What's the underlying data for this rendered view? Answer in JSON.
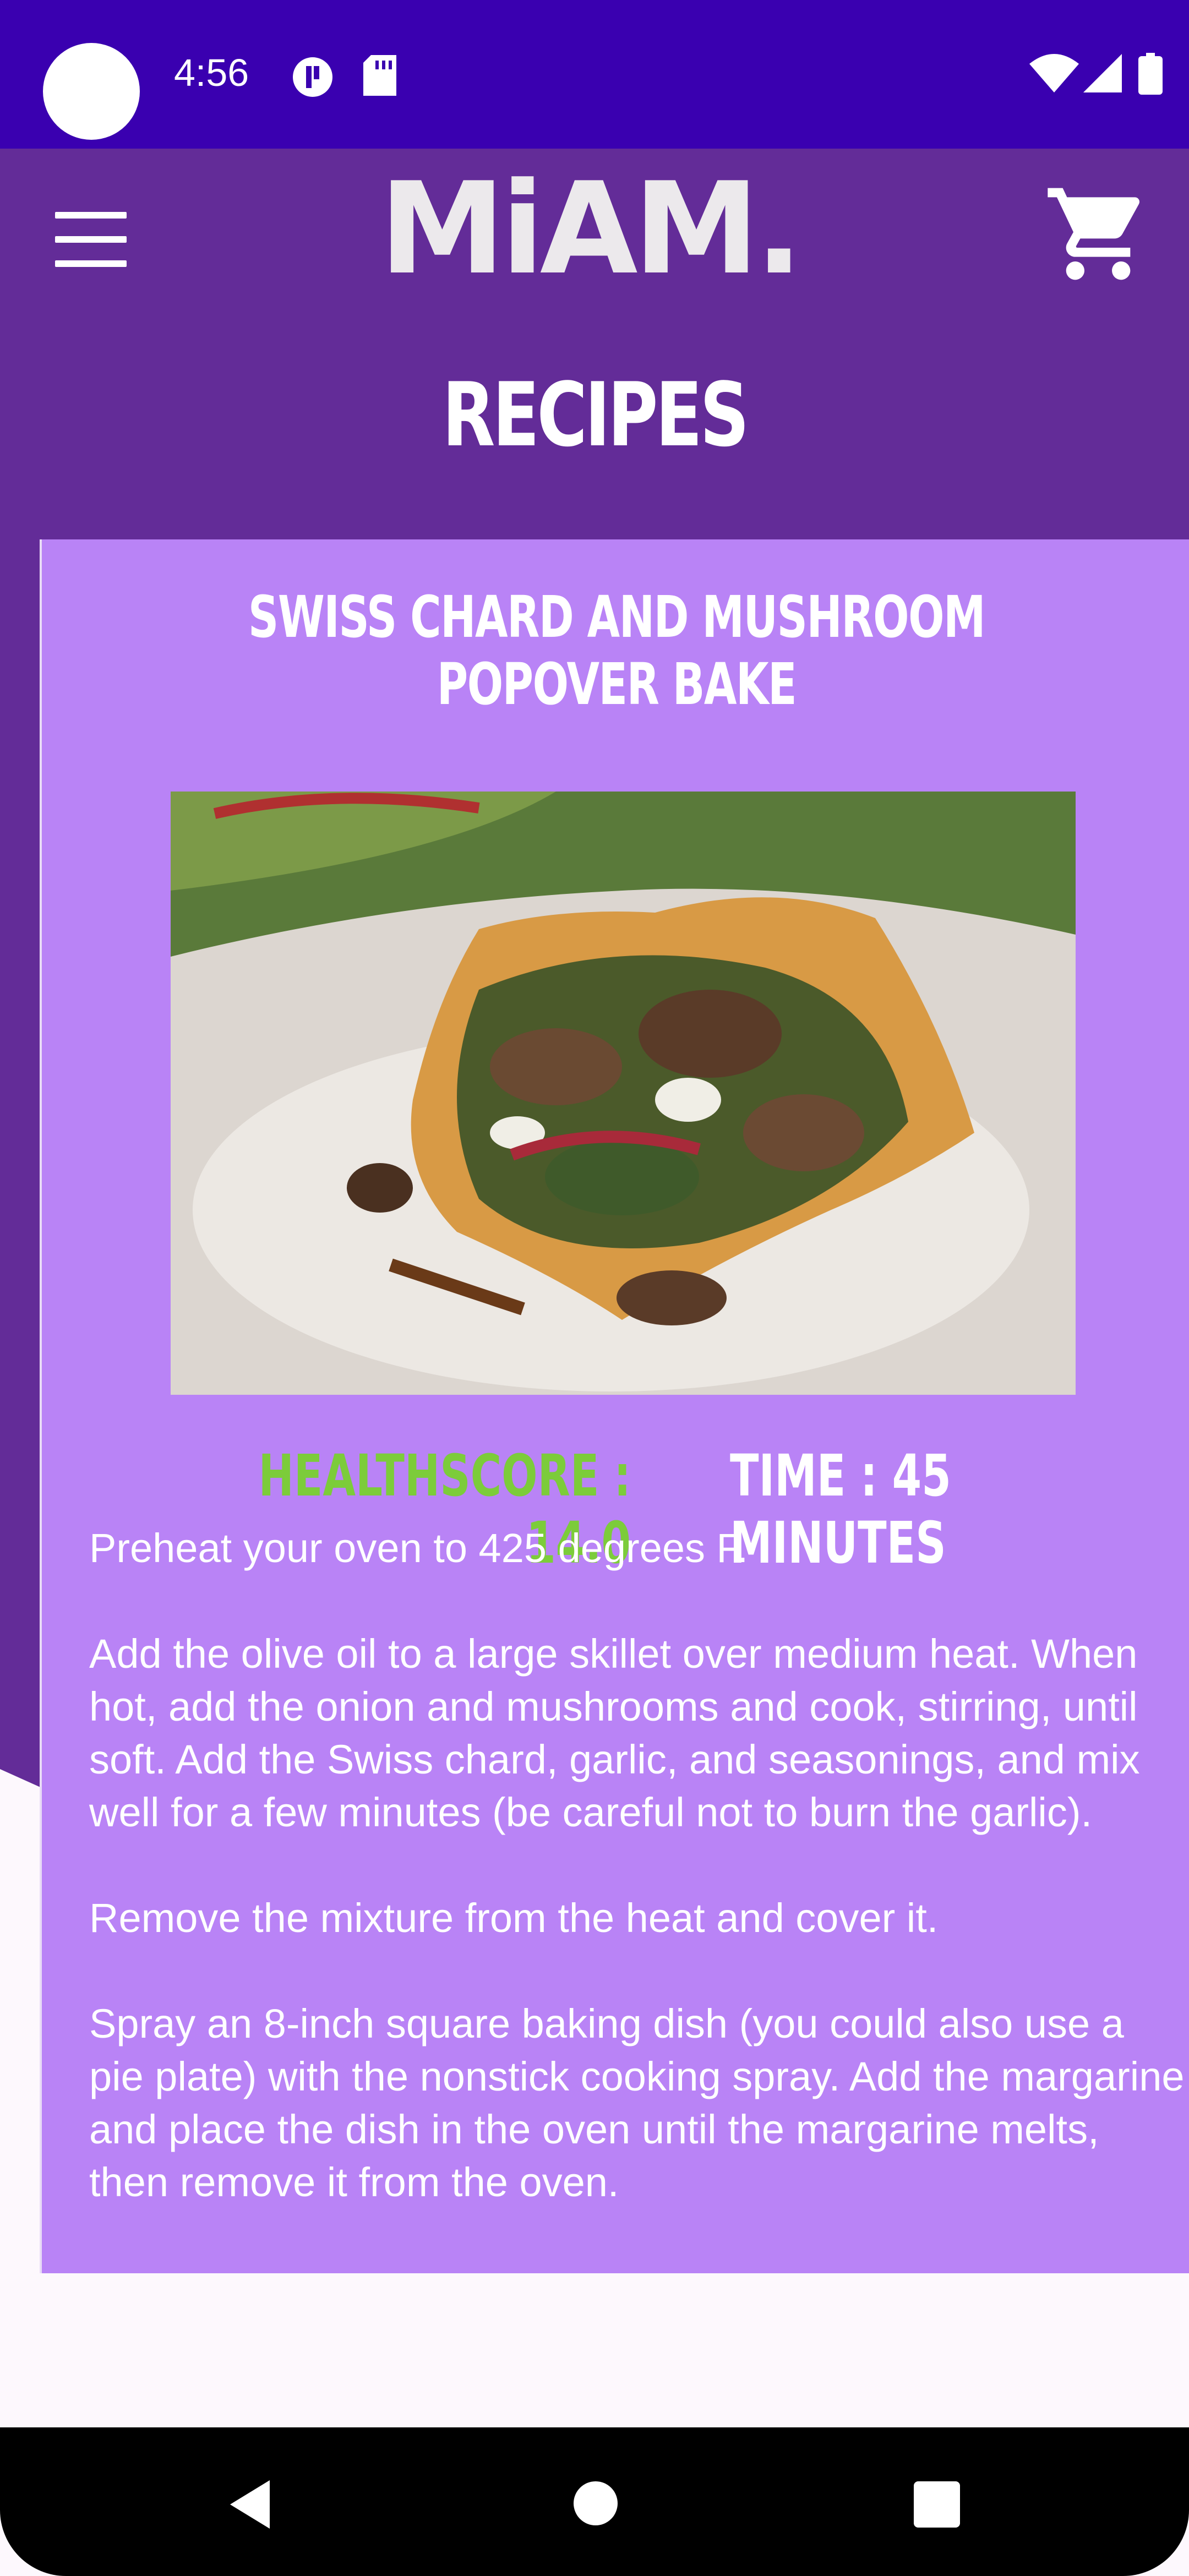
{
  "status_bar": {
    "time": "4:56"
  },
  "app_bar": {
    "logo_text": "MiAM.",
    "page_title": "RECIPES"
  },
  "recipe": {
    "title": "SWISS CHARD AND MUSHROOM POPOVER BAKE",
    "healthscore": "HEALTHSCORE : 14.0",
    "time": "TIME : 45 MINUTES",
    "instructions": [
      "Preheat your oven to 425 degrees F.",
      "Add the olive oil to a large skillet over medium heat. When hot, add the onion and mushrooms and cook, stirring, until soft. Add the Swiss chard, garlic, and seasonings, and mix well for a few minutes (be careful not to burn the garlic).",
      "Remove the mixture from the heat and cover it.",
      "Spray an 8-inch square baking dish (you could also use a pie plate) with the nonstick cooking spray. Add the margarine and place the dish in the oven until the margarine melts, then remove it from the oven."
    ]
  },
  "colors": {
    "status_bar": "#3a00b0",
    "app_bar": "#632c98",
    "card": "#b983f6",
    "healthscore": "#7ccc3a"
  },
  "icons": [
    "menu-icon",
    "cart-icon",
    "back-icon",
    "home-icon",
    "recents-icon"
  ]
}
